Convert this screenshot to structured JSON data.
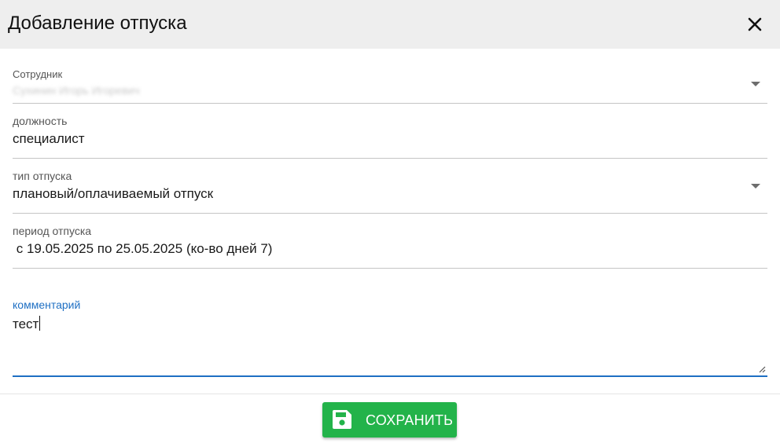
{
  "dialog": {
    "title": "Добавление отпуска",
    "close_icon": "close-icon"
  },
  "form": {
    "employee": {
      "label": "Сотрудник",
      "value": "Сухинин Игорь Игоревич"
    },
    "position": {
      "label": "должность",
      "value": "специалист"
    },
    "leave_type": {
      "label": "тип отпуска",
      "value": "плановый/оплачиваемый отпуск"
    },
    "leave_period": {
      "label": "период отпуска",
      "value": " с 19.05.2025 по 25.05.2025 (ко-во дней 7)"
    },
    "comment": {
      "label": "комментарий",
      "value": "тест"
    }
  },
  "footer": {
    "save_label": "СОХРАНИТЬ",
    "save_icon": "floppy-disk-icon"
  },
  "colors": {
    "header_bg": "#eeeeee",
    "accent": "#1e6fc3",
    "save_button": "#23b34a"
  }
}
